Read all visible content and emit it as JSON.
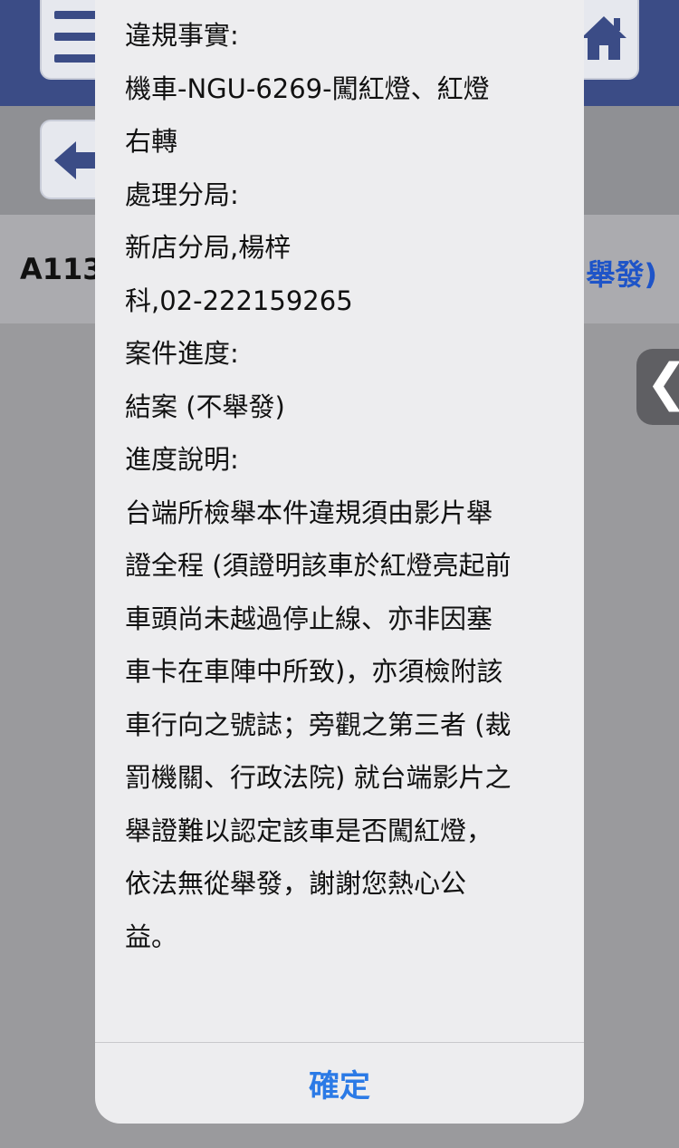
{
  "background": {
    "case_id": "A113",
    "case_status_partial": "舉發)"
  },
  "alert": {
    "lines": [
      "違規事實:",
      "機車-NGU-6269-闖紅燈、紅燈",
      "右轉",
      "處理分局:",
      "新店分局,楊梓",
      "科,02-222159265",
      "案件進度:",
      "結案 (不舉發)",
      "進度說明:",
      "台端所檢舉本件違規須由影片舉",
      "證全程 (須證明該車於紅燈亮起前",
      "車頭尚未越過停止線、亦非因塞",
      "車卡在車陣中所致)，亦須檢附該",
      "車行向之號誌；旁觀之第三者 (裁",
      "罰機關、行政法院) 就台端影片之",
      "舉證難以認定該車是否闖紅燈，",
      "依法無從舉發，謝謝您熱心公",
      "益。"
    ],
    "confirm_label": "確定"
  },
  "colors": {
    "header": "#3b4c86",
    "link": "#1e54c8",
    "ok_button": "#2b7ae6"
  }
}
